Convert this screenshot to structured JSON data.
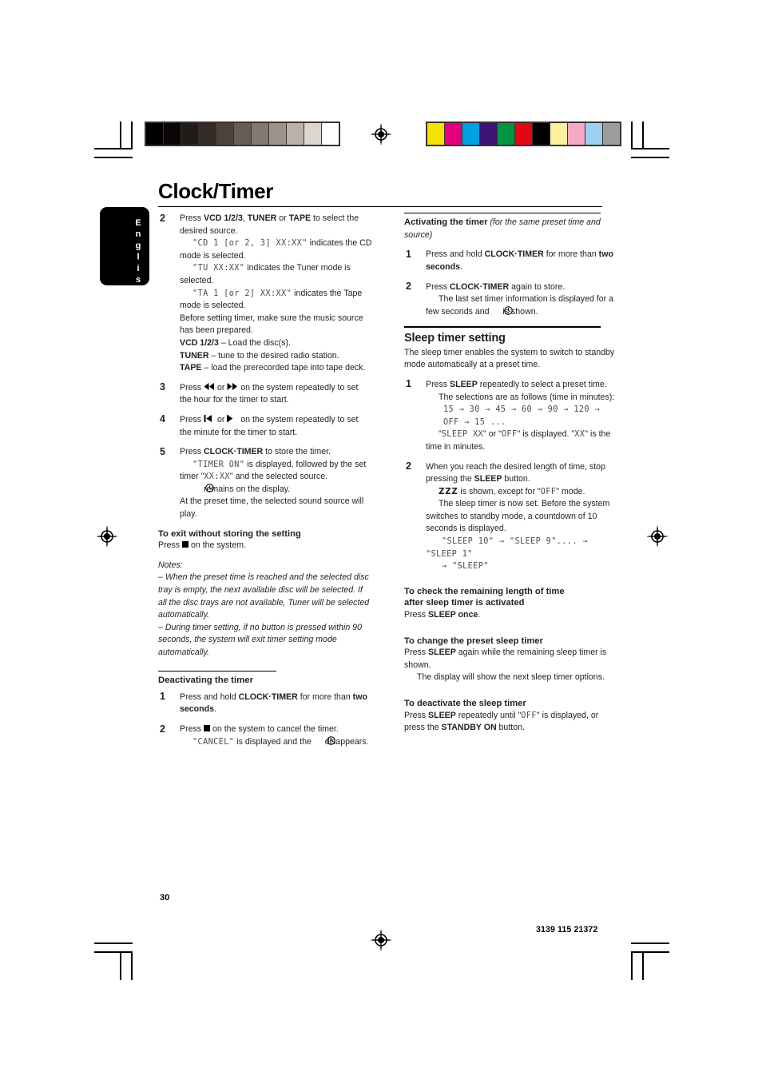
{
  "document": {
    "title": "Clock/Timer",
    "language_tab": "English",
    "page_number": "30",
    "doc_code": "3139 115 21372"
  },
  "calibration": {
    "grayscale_patches": [
      "#000000",
      "#0a0607",
      "#211c19",
      "#332b26",
      "#4a423c",
      "#665d56",
      "#827971",
      "#9d948c",
      "#bbb2a9",
      "#dcd6cf",
      "#ffffff"
    ],
    "color_patches": [
      "#f5e400",
      "#e2007d",
      "#009fe3",
      "#3d1475",
      "#009640",
      "#e30613",
      "#000000",
      "#faf0a0",
      "#f6a8c4",
      "#9cd2f0",
      "#9d9d9c"
    ]
  },
  "left_column": {
    "step2": {
      "num": "2",
      "line1_pre": "Press ",
      "line1_b1": "VCD 1/2/3",
      "line1_mid1": ", ",
      "line1_b2": "TUNER",
      "line1_mid2": " or ",
      "line1_b3": "TAPE",
      "line1_post": " to select the desired source.",
      "cd_lcd": "\"CD 1 [or 2, 3] XX:XX\"",
      "cd_text": " indicates the CD mode is selected.",
      "tu_lcd": "\"TU XX:XX\"",
      "tu_text": " indicates the Tuner mode is selected.",
      "ta_lcd": "\"TA 1 [or 2] XX:XX\"",
      "ta_text": " indicates the Tape mode is selected.",
      "prepare": "Before setting timer, make sure the music source has been prepared.",
      "vcd_label": "VCD 1/2/3",
      "vcd_text": " – Load the disc(s).",
      "tuner_label": "TUNER",
      "tuner_text": " – tune to the desired radio station.",
      "tape_label": "TAPE",
      "tape_text": " – load the prerecorded tape into tape deck."
    },
    "step3": {
      "num": "3",
      "pre": "Press ",
      "mid": " or ",
      "post": " on the system repeatedly to set the hour for the timer to start."
    },
    "step4": {
      "num": "4",
      "pre": "Press ",
      "mid": " or ",
      "post": " on the system repeatedly to set the minute for the timer to start."
    },
    "step5": {
      "num": "5",
      "pre": "Press ",
      "b": "CLOCK·TIMER",
      "post": " to store the timer.",
      "timer_on_lcd": "\"TIMER ON\"",
      "timer_on_text": " is displayed, followed by the set timer \"",
      "timer_xx_lcd": "XX:XX",
      "timer_on_text2": "\" and the selected source.",
      "clock_remains": " remains on the display.",
      "preset_note": "At the preset time, the selected sound source will play."
    },
    "exit_section": {
      "heading": "To exit without storing the setting",
      "pre": "Press ",
      "post": " on the system."
    },
    "notes": {
      "label": "Notes:",
      "note1": "–  When the preset time is reached and the selected disc tray is empty, the next available disc will be selected.  If all the disc trays are not available, Tuner will be selected automatically.",
      "note2": "–  During timer setting, if no button is pressed within 90 seconds, the system will exit timer setting mode automatically."
    },
    "deactivate_section": {
      "heading": "Deactivating the timer",
      "step1": {
        "num": "1",
        "pre": "Press and hold ",
        "b": "CLOCK·TIMER",
        "mid": " for more than ",
        "b2": "two seconds",
        "post": "."
      },
      "step2": {
        "num": "2",
        "pre": "Press ",
        "post": " on the system to cancel the timer.",
        "cancel_lcd": "\"CANCEL\"",
        "cancel_text": " is displayed and the ",
        "cancel_text2": " disappears."
      }
    }
  },
  "right_column": {
    "activating_section": {
      "heading": "Activating the timer",
      "heading_italic": "(for the same preset time and source)",
      "step1": {
        "num": "1",
        "pre": "Press and hold ",
        "b": "CLOCK·TIMER",
        "mid": " for more than ",
        "b2": "two seconds",
        "post": "."
      },
      "step2": {
        "num": "2",
        "pre": "Press ",
        "b": "CLOCK·TIMER",
        "post": " again to store.",
        "detail_pre": "The last set timer information is displayed for a few seconds and ",
        "detail_post": " is shown."
      }
    },
    "sleep_section": {
      "heading": "Sleep timer setting",
      "intro": "The sleep timer enables the system to switch to standby mode automatically at a preset time.",
      "step1": {
        "num": "1",
        "pre": "Press ",
        "b": "SLEEP",
        "post": " repeatedly to select a preset time.",
        "selections": "The selections are as follows (time in minutes):",
        "sequence_lcd_1": "15 → 30 → 45 → 60 → 90 → 120 →",
        "sequence_lcd_2": "OFF → 15 ...",
        "display_pre": "\"",
        "display_sleep": "SLEEP XX",
        "display_mid": "\" or \"",
        "display_off": "OFF",
        "display_post": "\" is displayed. \"",
        "display_xx": "XX",
        "display_end": "\" is the time in minutes."
      },
      "step2": {
        "num": "2",
        "pre": "When you reach the desired length of time, stop pressing the ",
        "b": "SLEEP",
        "post": " button.",
        "zzz": "ZZZ",
        "zzz_text": " is shown, except for \"",
        "zzz_off": "OFF",
        "zzz_text2": "\" mode.",
        "countdown_text": "The sleep timer is now set. Before the system switches to standby mode, a countdown of 10 seconds is displayed.",
        "countdown_lcd_1": "\"SLEEP 10\" → \"SLEEP 9\".... → \"SLEEP 1\"",
        "countdown_lcd_2": "→ \"SLEEP\""
      }
    },
    "check_section": {
      "heading_line1": "To check the remaining length of time",
      "heading_line2": "after sleep timer is activated",
      "pre": "Press ",
      "b": "SLEEP once",
      "post": "."
    },
    "change_section": {
      "heading": "To change the preset sleep timer",
      "pre": "Press ",
      "b": "SLEEP",
      "post": " again while the remaining sleep timer is shown.",
      "detail": "The display will show the next sleep timer options."
    },
    "deactivate_sleep_section": {
      "heading": " To deactivate the sleep timer",
      "pre": "Press ",
      "b": "SLEEP",
      "mid": " repeatedly until \"",
      "lcd_off": "OFF",
      "mid2": "\" is displayed, or press the ",
      "b2": "STANDBY ON",
      "post": " button."
    }
  }
}
